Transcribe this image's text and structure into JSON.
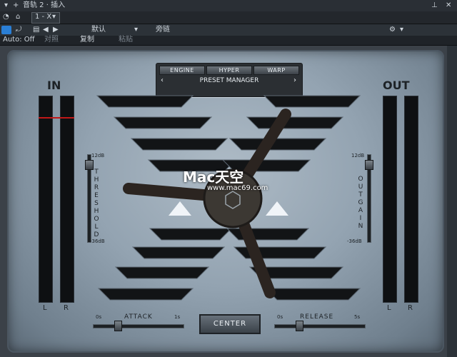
{
  "titlebar": {
    "track_title": "音轨 2 · 插入",
    "pin_icon": "pin-icon",
    "close_icon": "close-icon"
  },
  "row2": {
    "insert_slot": "1 - X"
  },
  "toolbar": {
    "preset_default": "默认",
    "bypass_label": "旁链",
    "auto_label": "Auto: Off",
    "compare_label": "对照",
    "copy_label": "复制",
    "paste_label": "粘贴"
  },
  "plugin": {
    "modes": [
      "ENGINE",
      "HYPER",
      "WARP"
    ],
    "preset_manager": "PRESET MANAGER",
    "in_label": "IN",
    "out_label": "OUT",
    "left": "L",
    "right": "R",
    "threshold_label": "THRESHOLD",
    "threshold_top": "12dB",
    "threshold_bottom": "-36dB",
    "outgain_label": "OUTGAIN",
    "outgain_top": "12dB",
    "outgain_bottom": "-36dB",
    "attack_label": "ATTACK",
    "attack_min": "0s",
    "attack_max": "1s",
    "release_label": "RELEASE",
    "release_min": "0s",
    "release_max": "5s",
    "center_label": "CENTER",
    "in_level": 0.03,
    "threshold_value": 0.9,
    "outgain_value": 0.9,
    "attack_value": 0.25,
    "release_value": 0.28
  },
  "watermark": {
    "brand": "Mac天空",
    "url": "www.mac69.com"
  }
}
